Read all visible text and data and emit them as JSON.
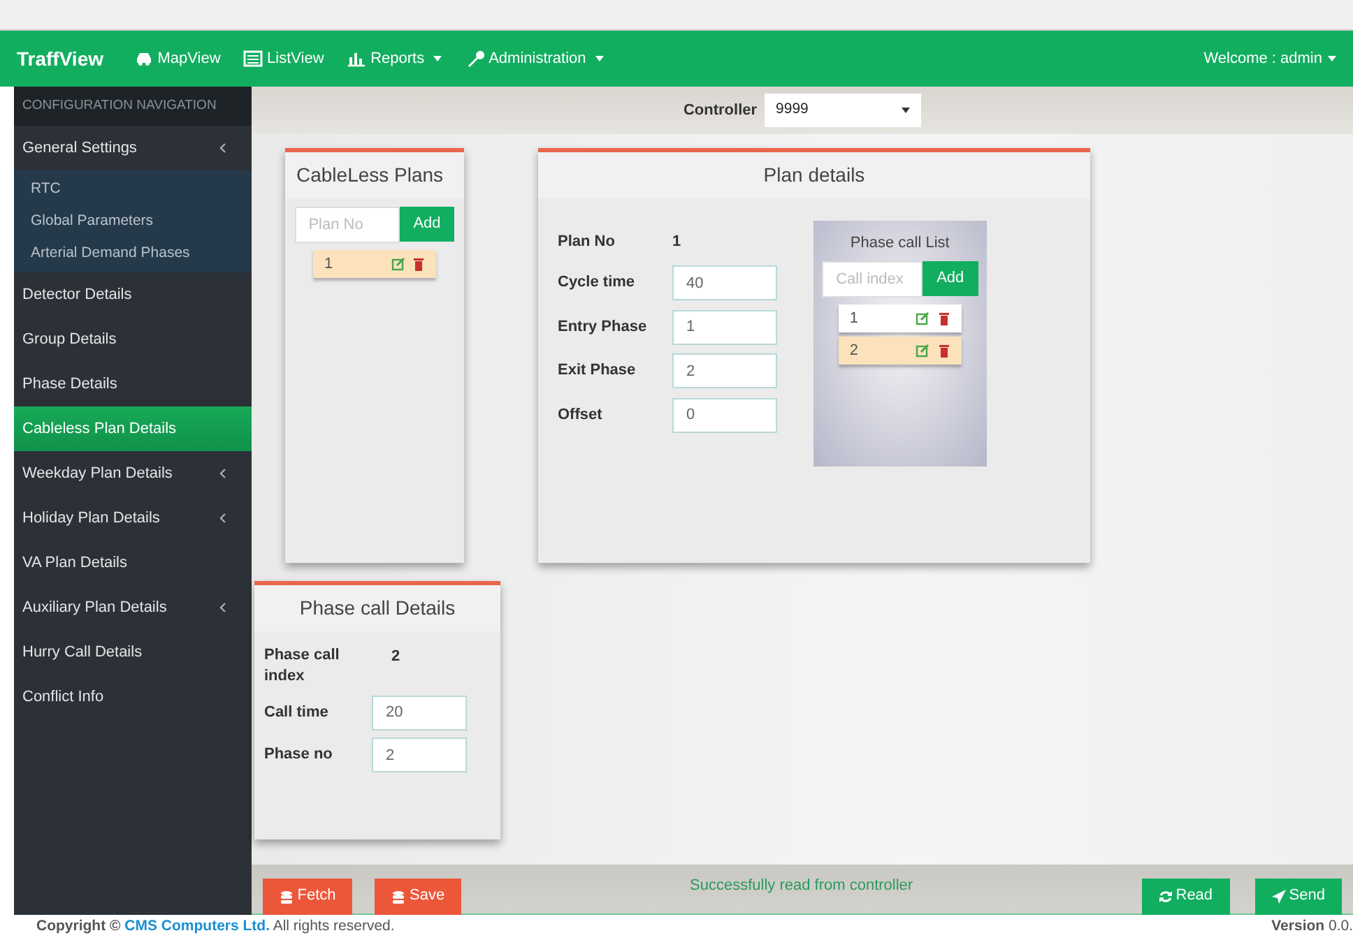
{
  "navbar": {
    "brand": "TraffView",
    "links": [
      {
        "label": "MapView",
        "kind": "link"
      },
      {
        "label": "ListView",
        "kind": "link"
      },
      {
        "label": "Reports",
        "kind": "dropdown"
      },
      {
        "label": "Administration",
        "kind": "dropdown"
      }
    ],
    "user": "Welcome : admin"
  },
  "sidebar": {
    "header": "CONFIGURATION NAVIGATION",
    "items": [
      {
        "label": "General Settings",
        "selected": false,
        "expandable": true,
        "children": [
          {
            "label": "RTC"
          },
          {
            "label": "Global Parameters"
          },
          {
            "label": "Arterial Demand Phases"
          }
        ]
      },
      {
        "label": "Detector Details",
        "selected": false,
        "expandable": false
      },
      {
        "label": "Group Details",
        "selected": false,
        "expandable": false
      },
      {
        "label": "Phase Details",
        "selected": false,
        "expandable": false
      },
      {
        "label": "Cableless Plan Details",
        "selected": true,
        "expandable": false
      },
      {
        "label": "Weekday Plan Details",
        "selected": false,
        "expandable": true
      },
      {
        "label": "Holiday Plan Details",
        "selected": false,
        "expandable": true
      },
      {
        "label": "VA Plan Details",
        "selected": false,
        "expandable": false
      },
      {
        "label": "Auxiliary Plan Details",
        "selected": false,
        "expandable": true
      },
      {
        "label": "Hurry Call Details",
        "selected": false,
        "expandable": false
      },
      {
        "label": "Conflict Info",
        "selected": false,
        "expandable": false
      }
    ]
  },
  "controller": {
    "label": "Controller",
    "value": "9999"
  },
  "cableless_plans": {
    "title": "CableLess Plans",
    "placeholder": "Plan No",
    "add": "Add",
    "items": [
      {
        "label": "1",
        "selected": true
      }
    ]
  },
  "plan_details": {
    "title": "Plan details",
    "plan_no_label": "Plan No",
    "plan_no": "1",
    "fields": [
      {
        "label": "Cycle time",
        "value": "40"
      },
      {
        "label": "Entry Phase",
        "value": "1"
      },
      {
        "label": "Exit Phase",
        "value": "2"
      },
      {
        "label": "Offset",
        "value": "0"
      }
    ],
    "phase_call_list": {
      "title": "Phase call List",
      "placeholder": "Call index",
      "add": "Add",
      "items": [
        {
          "label": "1",
          "selected": false
        },
        {
          "label": "2",
          "selected": true
        }
      ]
    }
  },
  "phase_call_details": {
    "title": "Phase call Details",
    "index_label": "Phase call index",
    "index": "2",
    "fields": [
      {
        "label": "Call time",
        "value": "20"
      },
      {
        "label": "Phase no",
        "value": "2"
      }
    ]
  },
  "actions": {
    "left": [
      {
        "label": "Fetch",
        "kind": "database"
      },
      {
        "label": "Save",
        "kind": "database"
      }
    ],
    "status": "Successfully read from controller",
    "right": [
      {
        "label": "Read",
        "kind": "refresh"
      },
      {
        "label": "Send",
        "kind": "send"
      }
    ]
  },
  "footer": {
    "copyright": "Copyright ©",
    "company": "CMS Computers Ltd.",
    "rights": "All rights reserved.",
    "version_label": "Version",
    "version": "0.0."
  }
}
